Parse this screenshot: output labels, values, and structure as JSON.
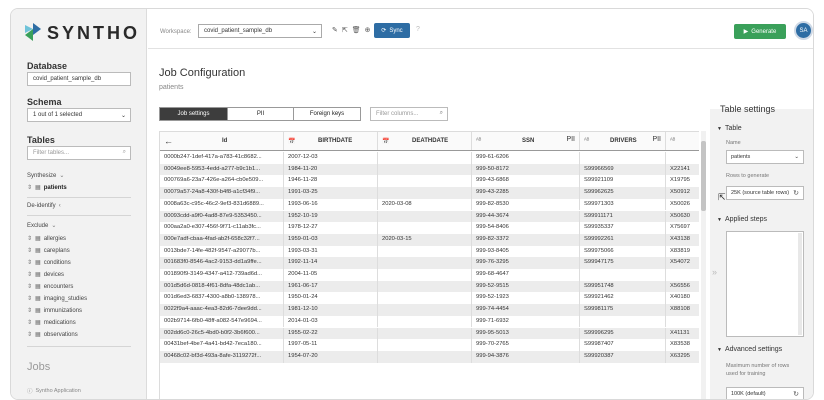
{
  "brand": {
    "name": "SYNTHO"
  },
  "sidebar": {
    "database_label": "Database",
    "database_value": "covid_patient_sample_db",
    "schema_label": "Schema",
    "schema_value": "1 out of 1 selected",
    "tables_label": "Tables",
    "tables_placeholder": "Filter tables...",
    "synthesize_label": "Synthesize",
    "synthesize_tables": [
      "patients"
    ],
    "deidentify_label": "De-identify",
    "exclude_label": "Exclude",
    "exclude_tables": [
      "allergies",
      "careplans",
      "conditions",
      "devices",
      "encounters",
      "imaging_studies",
      "immunizations",
      "medications",
      "observations"
    ],
    "jobs_label": "Jobs",
    "footer": "Syntho Application"
  },
  "topbar": {
    "workspace_label": "Workspace:",
    "workspace_value": "covid_patient_sample_db",
    "sync_label": "Sync",
    "generate_label": "Generate",
    "avatar_initials": "SA"
  },
  "main": {
    "title": "Job Configuration",
    "subtitle": "patients",
    "tabs": [
      "Job settings",
      "PII",
      "Foreign keys"
    ],
    "filter_placeholder": "Filter columns...",
    "columns": [
      {
        "name": "Id",
        "pii": ""
      },
      {
        "name": "BIRTHDATE",
        "pii": ""
      },
      {
        "name": "DEATHDATE",
        "pii": ""
      },
      {
        "name": "SSN",
        "pii": "PII"
      },
      {
        "name": "DRIVERS",
        "pii": "PII"
      }
    ],
    "rows": [
      [
        "0000b247-1def-417a-a783-41c8682...",
        "2007-12-03",
        "",
        "999-61-6206",
        "",
        ""
      ],
      [
        "00049ee8-5953-4edd-a277-b9c1b1...",
        "1984-11-20",
        "",
        "999-50-8172",
        "S99966569",
        "X22141"
      ],
      [
        "000769a6-23a7-426e-a264-cb0e509...",
        "1946-11-28",
        "",
        "999-43-6868",
        "S99921109",
        "X19795"
      ],
      [
        "00079a57-24a8-430f-b4f8-a1cf34f9...",
        "1991-03-25",
        "",
        "999-43-2285",
        "S99962625",
        "X50912"
      ],
      [
        "0008a63c-c95c-46c2-9ef3-831d6889...",
        "1993-06-16",
        "2020-03-08",
        "999-82-8530",
        "S99971303",
        "X50026"
      ],
      [
        "00093cdd-a9f0-4ad8-87e9-5353450...",
        "1952-10-19",
        "",
        "999-44-3674",
        "S99911171",
        "X50630"
      ],
      [
        "000aa2a0-e307-456f-9f71-c11ab3fc...",
        "1978-12-27",
        "",
        "999-54-8406",
        "S99935337",
        "X75697"
      ],
      [
        "000e7adf-cbaa-4fad-ab2f-658c32f7...",
        "1959-01-03",
        "2020-03-15",
        "999-82-3372",
        "S99992261",
        "X43138"
      ],
      [
        "0013bde7-14fe-482f-9547-a29077b...",
        "1993-03-31",
        "",
        "999-93-8405",
        "S99975066",
        "X83819"
      ],
      [
        "001683f0-8546-4ac2-9153-dd1a9ffe...",
        "1992-11-14",
        "",
        "999-76-3295",
        "S99947175",
        "X54072"
      ],
      [
        "001890f9-3149-4347-a412-739ad6d...",
        "2004-11-05",
        "",
        "999-68-4647",
        "",
        ""
      ],
      [
        "001d5d6d-0818-4f61-8dfa-48dc1ab...",
        "1961-06-17",
        "",
        "999-52-9515",
        "S99951748",
        "X56556"
      ],
      [
        "001d6ed3-6837-4300-a8b0-138978...",
        "1950-01-24",
        "",
        "999-52-1923",
        "S99921462",
        "X40180"
      ],
      [
        "0022f9a4-aaac-4ea3-82d6-7dee9dd...",
        "1981-12-10",
        "",
        "999-74-4454",
        "S99981175",
        "X88108"
      ],
      [
        "002b9714-6fb0-48ff-a082-547e9694...",
        "2014-01-03",
        "",
        "999-71-6932",
        "",
        ""
      ],
      [
        "002dd6c0-26c5-4bd0-b0f2-3b6f600...",
        "1955-02-22",
        "",
        "999-95-5013",
        "S99996295",
        "X41131"
      ],
      [
        "00431bef-4be7-4a41-bd42-7eca180...",
        "1997-05-11",
        "",
        "999-70-2765",
        "S99987407",
        "X83538"
      ],
      [
        "00468c02-bf3d-493a-8afe-3119272f...",
        "1954-07-20",
        "",
        "999-94-3876",
        "S99920387",
        "X63295"
      ]
    ]
  },
  "panel": {
    "title": "Table settings",
    "table_section": "Table",
    "name_label": "Name",
    "name_value": "patients",
    "rows_label": "Rows to generate",
    "rows_value": "25K (source table rows)",
    "applied_steps": "Applied steps",
    "advanced": "Advanced settings",
    "max_rows_label_1": "Maximum number of rows",
    "max_rows_label_2": "used for training",
    "max_rows_value": "100K (default)"
  }
}
